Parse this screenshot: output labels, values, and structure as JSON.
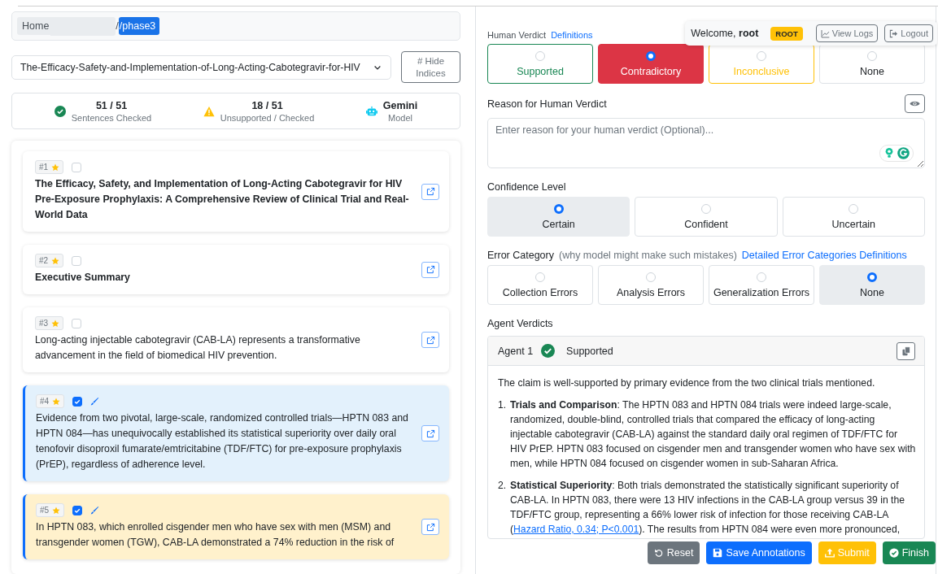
{
  "breadcrumb": [
    {
      "text": "Home",
      "selected": false
    },
    {
      "kind": "redacted"
    },
    {
      "text": "/",
      "selected": false
    },
    {
      "text": "/phase3",
      "selected": true
    }
  ],
  "document_select": {
    "value": "The-Efficacy-Safety-and-Implementation-of-Long-Acting-Cabotegravir-for-HIV"
  },
  "hide_indices_button": {
    "icon": "#",
    "label": "Hide Indices"
  },
  "stats": [
    {
      "kind": "success",
      "value": "51 / 51",
      "label": "Sentences Checked"
    },
    {
      "kind": "warning",
      "value": "18 / 51",
      "label": "Unsupported / Checked"
    },
    {
      "kind": "model",
      "value": "Gemini",
      "label": "Model"
    }
  ],
  "sentences": [
    {
      "index": "#1",
      "kind": "title",
      "checked": false,
      "selected": false,
      "flagged": false,
      "text": "The Efficacy, Safety, and Implementation of Long-Acting Cabotegravir for HIV Pre-Exposure Prophylaxis: A Comprehensive Review of Clinical Trial and Real-World Data"
    },
    {
      "index": "#2",
      "kind": "heading",
      "checked": false,
      "selected": false,
      "flagged": false,
      "text": "Executive Summary"
    },
    {
      "index": "#3",
      "kind": "text",
      "checked": false,
      "selected": false,
      "flagged": false,
      "text": "Long-acting injectable cabotegravir (CAB-LA) represents a transformative advancement in the field of biomedical HIV prevention."
    },
    {
      "index": "#4",
      "kind": "text",
      "checked": true,
      "selected": true,
      "flagged": false,
      "text": "Evidence from two pivotal, large-scale, randomized controlled trials—HPTN 083 and HPTN 084—has unequivocally established its statistical superiority over daily oral tenofovir disoproxil fumarate/emtricitabine (TDF/FTC) for pre-exposure prophylaxis (PrEP), regardless of adherence level."
    },
    {
      "index": "#5",
      "kind": "text",
      "checked": true,
      "selected": false,
      "flagged": true,
      "text": "In HPTN 083, which enrolled cisgender men who have sex with men (MSM) and transgender women (TGW), CAB-LA demonstrated a 74% reduction in the risk of"
    }
  ],
  "user": {
    "greeting": "Welcome,",
    "name": "root",
    "role": "ROOT"
  },
  "header_buttons": [
    {
      "kind": "logs",
      "label": "View Logs"
    },
    {
      "kind": "logout",
      "label": "Logout"
    }
  ],
  "human_verdict": {
    "label": "Human Verdict",
    "link": "Definitions",
    "options": [
      {
        "label": "Supported",
        "kind": "success",
        "selected": false
      },
      {
        "label": "Contradictory",
        "kind": "danger",
        "selected": true
      },
      {
        "label": "Inconclusive",
        "kind": "warning",
        "selected": false
      },
      {
        "label": "None",
        "kind": "neutral",
        "selected": false
      }
    ]
  },
  "reason": {
    "label": "Reason for Human Verdict",
    "placeholder": "Enter reason for your human verdict (Optional)..."
  },
  "confidence": {
    "label": "Confidence Level",
    "options": [
      {
        "label": "Certain",
        "selected": true
      },
      {
        "label": "Confident",
        "selected": false
      },
      {
        "label": "Uncertain",
        "selected": false
      }
    ]
  },
  "error_category": {
    "label": "Error Category",
    "note": "(why model might make such mistakes)",
    "link": "Detailed Error Categories Definitions",
    "options": [
      {
        "label": "Collection Errors",
        "selected": false
      },
      {
        "label": "Analysis Errors",
        "selected": false
      },
      {
        "label": "Generalization Errors",
        "selected": false
      },
      {
        "label": "None",
        "selected": true
      }
    ]
  },
  "agent_verdicts": {
    "label": "Agent Verdicts",
    "agents": [
      {
        "name": "Agent 1",
        "verdict": "Supported",
        "kind": "supported",
        "intro": "The claim is well-supported by primary evidence from the two clinical trials mentioned.",
        "points": [
          {
            "number": "1.",
            "text": "**Trials and Comparison**: The HPTN 083 and HPTN 084 trials were indeed large-scale, randomized, double-blind, controlled trials that compared the efficacy of long-acting injectable cabotegravir (CAB-LA) against the standard daily oral regimen of TDF/FTC for HIV PrEP. HPTN 083 focused on cisgender men and transgender women who have sex with men, while HPTN 084 focused on cisgender women in sub-Saharan Africa."
          },
          {
            "number": "2.",
            "text": "**Statistical Superiority**: Both trials demonstrated the statistically significant superiority of CAB-LA. In HPTN 083, there were 13 HIV infections in the CAB-LA group versus 39 in the TDF/FTC group, representing a 66% lower risk of infection for those receiving CAB-LA (",
            "link": "Hazard Ratio, 0.34; P<0.001",
            "after": "). The results from HPTN 084 were even more pronounced,"
          }
        ]
      }
    ]
  },
  "footer_buttons": [
    {
      "kind": "reset",
      "label": "Reset"
    },
    {
      "kind": "save",
      "label": "Save Annotations"
    },
    {
      "kind": "submit",
      "label": "Submit"
    },
    {
      "kind": "finish",
      "label": "Finish"
    }
  ]
}
